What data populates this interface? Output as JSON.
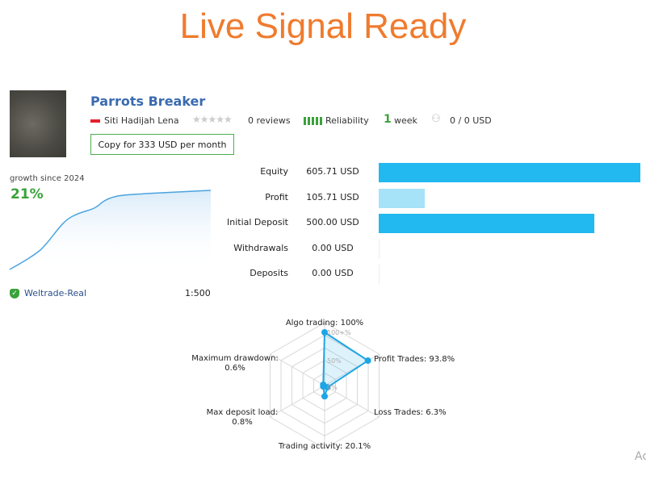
{
  "headline": "Live Signal Ready",
  "signal": {
    "name": "Parrots Breaker",
    "author": "Siti Hadijah Lena",
    "reviews": "0 reviews",
    "rating_stars": 0,
    "reliability_label": "Reliability",
    "age_num": "1",
    "age_unit": "week",
    "subscribers": "0 / 0 USD",
    "copy_button": "Copy for 333 USD per month"
  },
  "growth": {
    "label": "growth since 2024",
    "value": "21%",
    "broker": "Weltrade-Real",
    "leverage": "1:500"
  },
  "stats": [
    {
      "label": "Equity",
      "value": "605.71 USD",
      "amount": 605.71
    },
    {
      "label": "Profit",
      "value": "105.71 USD",
      "amount": 105.71
    },
    {
      "label": "Initial Deposit",
      "value": "500.00 USD",
      "amount": 500
    },
    {
      "label": "Withdrawals",
      "value": "0.00 USD",
      "amount": 0
    },
    {
      "label": "Deposits",
      "value": "0.00 USD",
      "amount": 0
    }
  ],
  "radar": {
    "ring_labels": [
      "100+%",
      "50%",
      "0%"
    ],
    "axes": [
      {
        "label": "Algo trading: 100%",
        "value": 100
      },
      {
        "label": "Profit Trades: 93.8%",
        "value": 93.8
      },
      {
        "label": "Loss Trades: 6.3%",
        "value": 6.3
      },
      {
        "label": "Trading activity: 20.1%",
        "value": 20.1
      },
      {
        "label": "Max deposit load:",
        "label2": "0.8%",
        "value": 0.8
      },
      {
        "label": "Maximum drawdown:",
        "label2": "0.6%",
        "value": 0.6
      }
    ]
  },
  "colors": {
    "accent": "#ef7b2e",
    "bar": "#22b8f0",
    "bar_light": "#a6e2f8",
    "green": "#3aa23a"
  },
  "watermark": "Ac"
}
